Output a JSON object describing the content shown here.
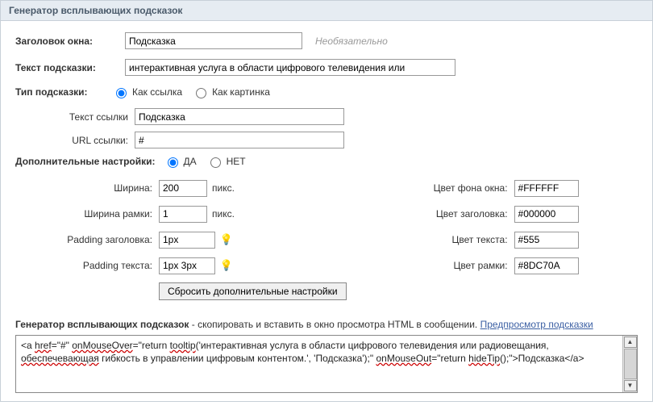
{
  "header": {
    "title": "Генератор всплывающих подсказок"
  },
  "fields": {
    "window_title": {
      "label": "Заголовок окна:",
      "value": "Подсказка",
      "hint": "Необязательно"
    },
    "tooltip_text": {
      "label": "Текст подсказки:",
      "value": "интерактивная услуга в области цифрового телевидения или"
    },
    "type": {
      "label": "Тип подсказки:",
      "opt_link": "Как ссылка",
      "opt_image": "Как картинка",
      "selected": "link"
    },
    "link_text": {
      "label": "Текст ссылки",
      "value": "Подсказка"
    },
    "link_url": {
      "label": "URL ссылки:",
      "value": "#"
    },
    "advanced": {
      "label": "Дополнительные настройки:",
      "opt_yes": "ДА",
      "opt_no": "НЕТ",
      "selected": "yes",
      "width": {
        "label": "Ширина:",
        "value": "200",
        "unit": "пикс."
      },
      "border_width": {
        "label": "Ширина рамки:",
        "value": "1",
        "unit": "пикс."
      },
      "padding_title": {
        "label": "Padding заголовка:",
        "value": "1px"
      },
      "padding_text": {
        "label": "Padding текста:",
        "value": "1px 3px"
      },
      "bg_color": {
        "label": "Цвет фона окна:",
        "value": "#FFFFFF"
      },
      "title_color": {
        "label": "Цвет заголовка:",
        "value": "#000000"
      },
      "text_color": {
        "label": "Цвет текста:",
        "value": "#555"
      },
      "border_color": {
        "label": "Цвет рамки:",
        "value": "#8DC70A"
      },
      "reset_btn": "Сбросить дополнительные настройки"
    }
  },
  "output": {
    "label_bold": "Генератор всплывающих подсказок",
    "label_rest": " - скопировать и вставить в окно просмотра HTML в сообщении. ",
    "preview_link": "Предпросмотр подсказки",
    "code": "<a href=\"#\" onMouseOver=\"return tooltip('интерактивная услуга в области цифрового телевидения или радиовещания, обеспечевающая гибкость в управлении цифровым контентом.', 'Подсказка');\" onMouseOut=\"return hideTip();\">Подсказка</a>"
  }
}
